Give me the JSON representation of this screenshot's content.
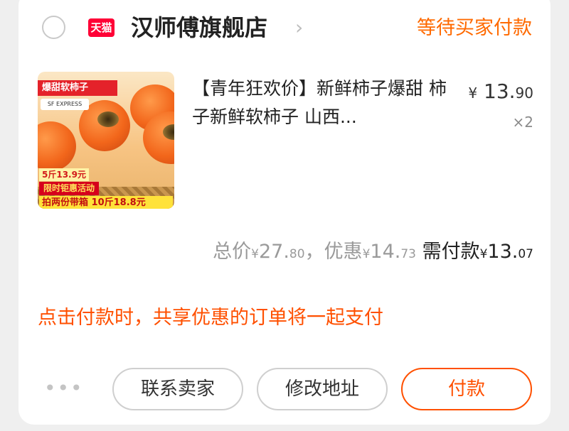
{
  "store": {
    "badge": "天猫",
    "name": "汉师傅旗舰店",
    "chevron": "›",
    "status": "等待买家付款"
  },
  "product": {
    "title": "【青年狂欢价】新鲜柿子爆甜 柿子新鲜软柿子 山西...",
    "price_symbol": "¥",
    "price_int": "13.",
    "price_dec": "90",
    "quantity": "×2",
    "thumb": {
      "banner": "爆甜软柿子",
      "express": "SF EXPRESS",
      "promo1": "5斤13.9元",
      "promo2": "限时钜惠活动",
      "promo3": "拍两份带箱 10斤18.8元"
    }
  },
  "summary": {
    "total_label": "总价",
    "total_int": "27.",
    "total_dec": "80",
    "separator": "，",
    "discount_label": "优惠",
    "discount_int": "14.",
    "discount_dec": "73",
    "due_label": "需付款",
    "due_int": "13.",
    "due_dec": "07",
    "currency": "¥"
  },
  "notice": "点击付款时，共享优惠的订单将一起支付",
  "actions": {
    "more": "•••",
    "contact_seller": "联系卖家",
    "change_address": "修改地址",
    "pay": "付款"
  },
  "colors": {
    "accent": "#ff5000",
    "status": "#ff6a00",
    "tmall": "#ff0036"
  }
}
